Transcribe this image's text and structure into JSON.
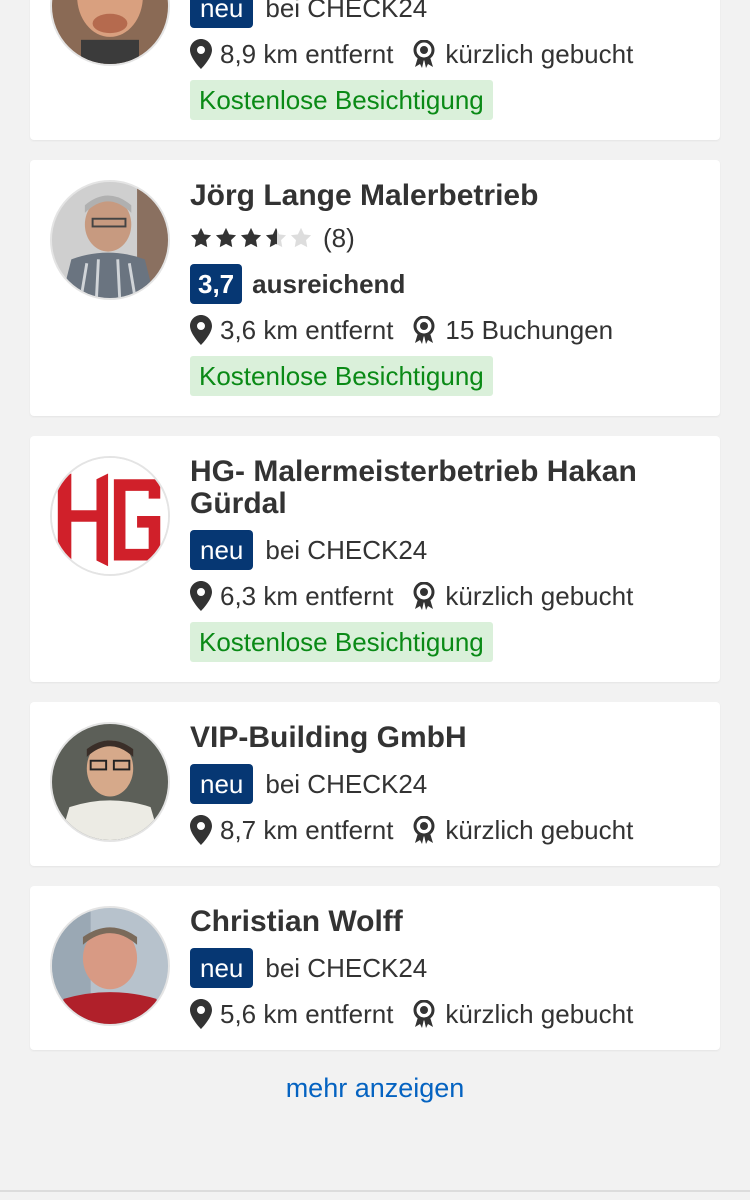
{
  "colors": {
    "brand_blue": "#063773",
    "green": "#0a8a16",
    "green_bg": "#daf0da",
    "link": "#0563c1"
  },
  "providers": [
    {
      "name": "",
      "new_badge": "neu",
      "new_text": "bei CHECK24",
      "distance": "8,9 km entfernt",
      "bookings": "kürzlich gebucht",
      "inspection": "Kostenlose Besichtigung"
    },
    {
      "name": "Jörg Lange Malerbetrieb",
      "rating_stars": 3.5,
      "rating_count": "(8)",
      "score": "3,7",
      "score_word": "ausreichend",
      "distance": "3,6 km entfernt",
      "bookings": "15 Buchungen",
      "inspection": "Kostenlose Besichtigung"
    },
    {
      "name": "HG- Malermeisterbetrieb Hakan Gürdal",
      "new_badge": "neu",
      "new_text": "bei CHECK24",
      "distance": "6,3 km entfernt",
      "bookings": "kürzlich gebucht",
      "inspection": "Kostenlose Besichtigung"
    },
    {
      "name": "VIP-Building GmbH",
      "new_badge": "neu",
      "new_text": "bei CHECK24",
      "distance": "8,7 km entfernt",
      "bookings": "kürzlich gebucht"
    },
    {
      "name": "Christian Wolff",
      "new_badge": "neu",
      "new_text": "bei CHECK24",
      "distance": "5,6 km entfernt",
      "bookings": "kürzlich gebucht"
    }
  ],
  "more_link": "mehr anzeigen",
  "icons": {
    "distance": "map-pin-icon",
    "bookings": "award-icon",
    "rating": "star-icon"
  }
}
